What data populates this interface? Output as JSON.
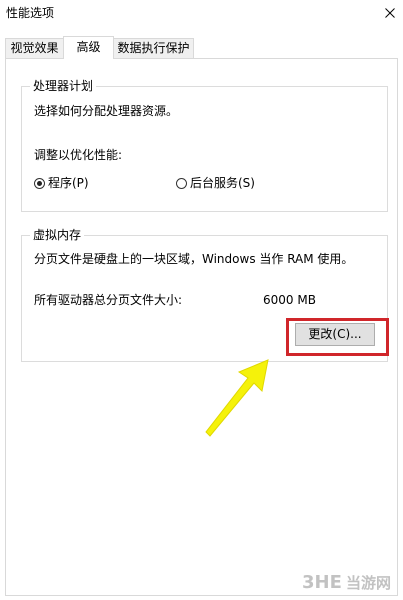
{
  "window": {
    "title": "性能选项"
  },
  "tabs": [
    {
      "label": "视觉效果"
    },
    {
      "label": "高级"
    },
    {
      "label": "数据执行保护"
    }
  ],
  "processor_group": {
    "title": "处理器计划",
    "description": "选择如何分配处理器资源。",
    "adjust_label": "调整以优化性能:",
    "options": [
      {
        "label": "程序(P)",
        "selected": true
      },
      {
        "label": "后台服务(S)",
        "selected": false
      }
    ]
  },
  "virtual_memory_group": {
    "title": "虚拟内存",
    "description": "分页文件是硬盘上的一块区域，Windows 当作 RAM 使用。",
    "total_label": "所有驱动器总分页文件大小:",
    "total_value": "6000 MB",
    "change_button_label": "更改(C)..."
  },
  "colors": {
    "highlight": "#d0262a",
    "arrow": "#f5f20a"
  },
  "icons": {
    "close": "close-icon"
  }
}
